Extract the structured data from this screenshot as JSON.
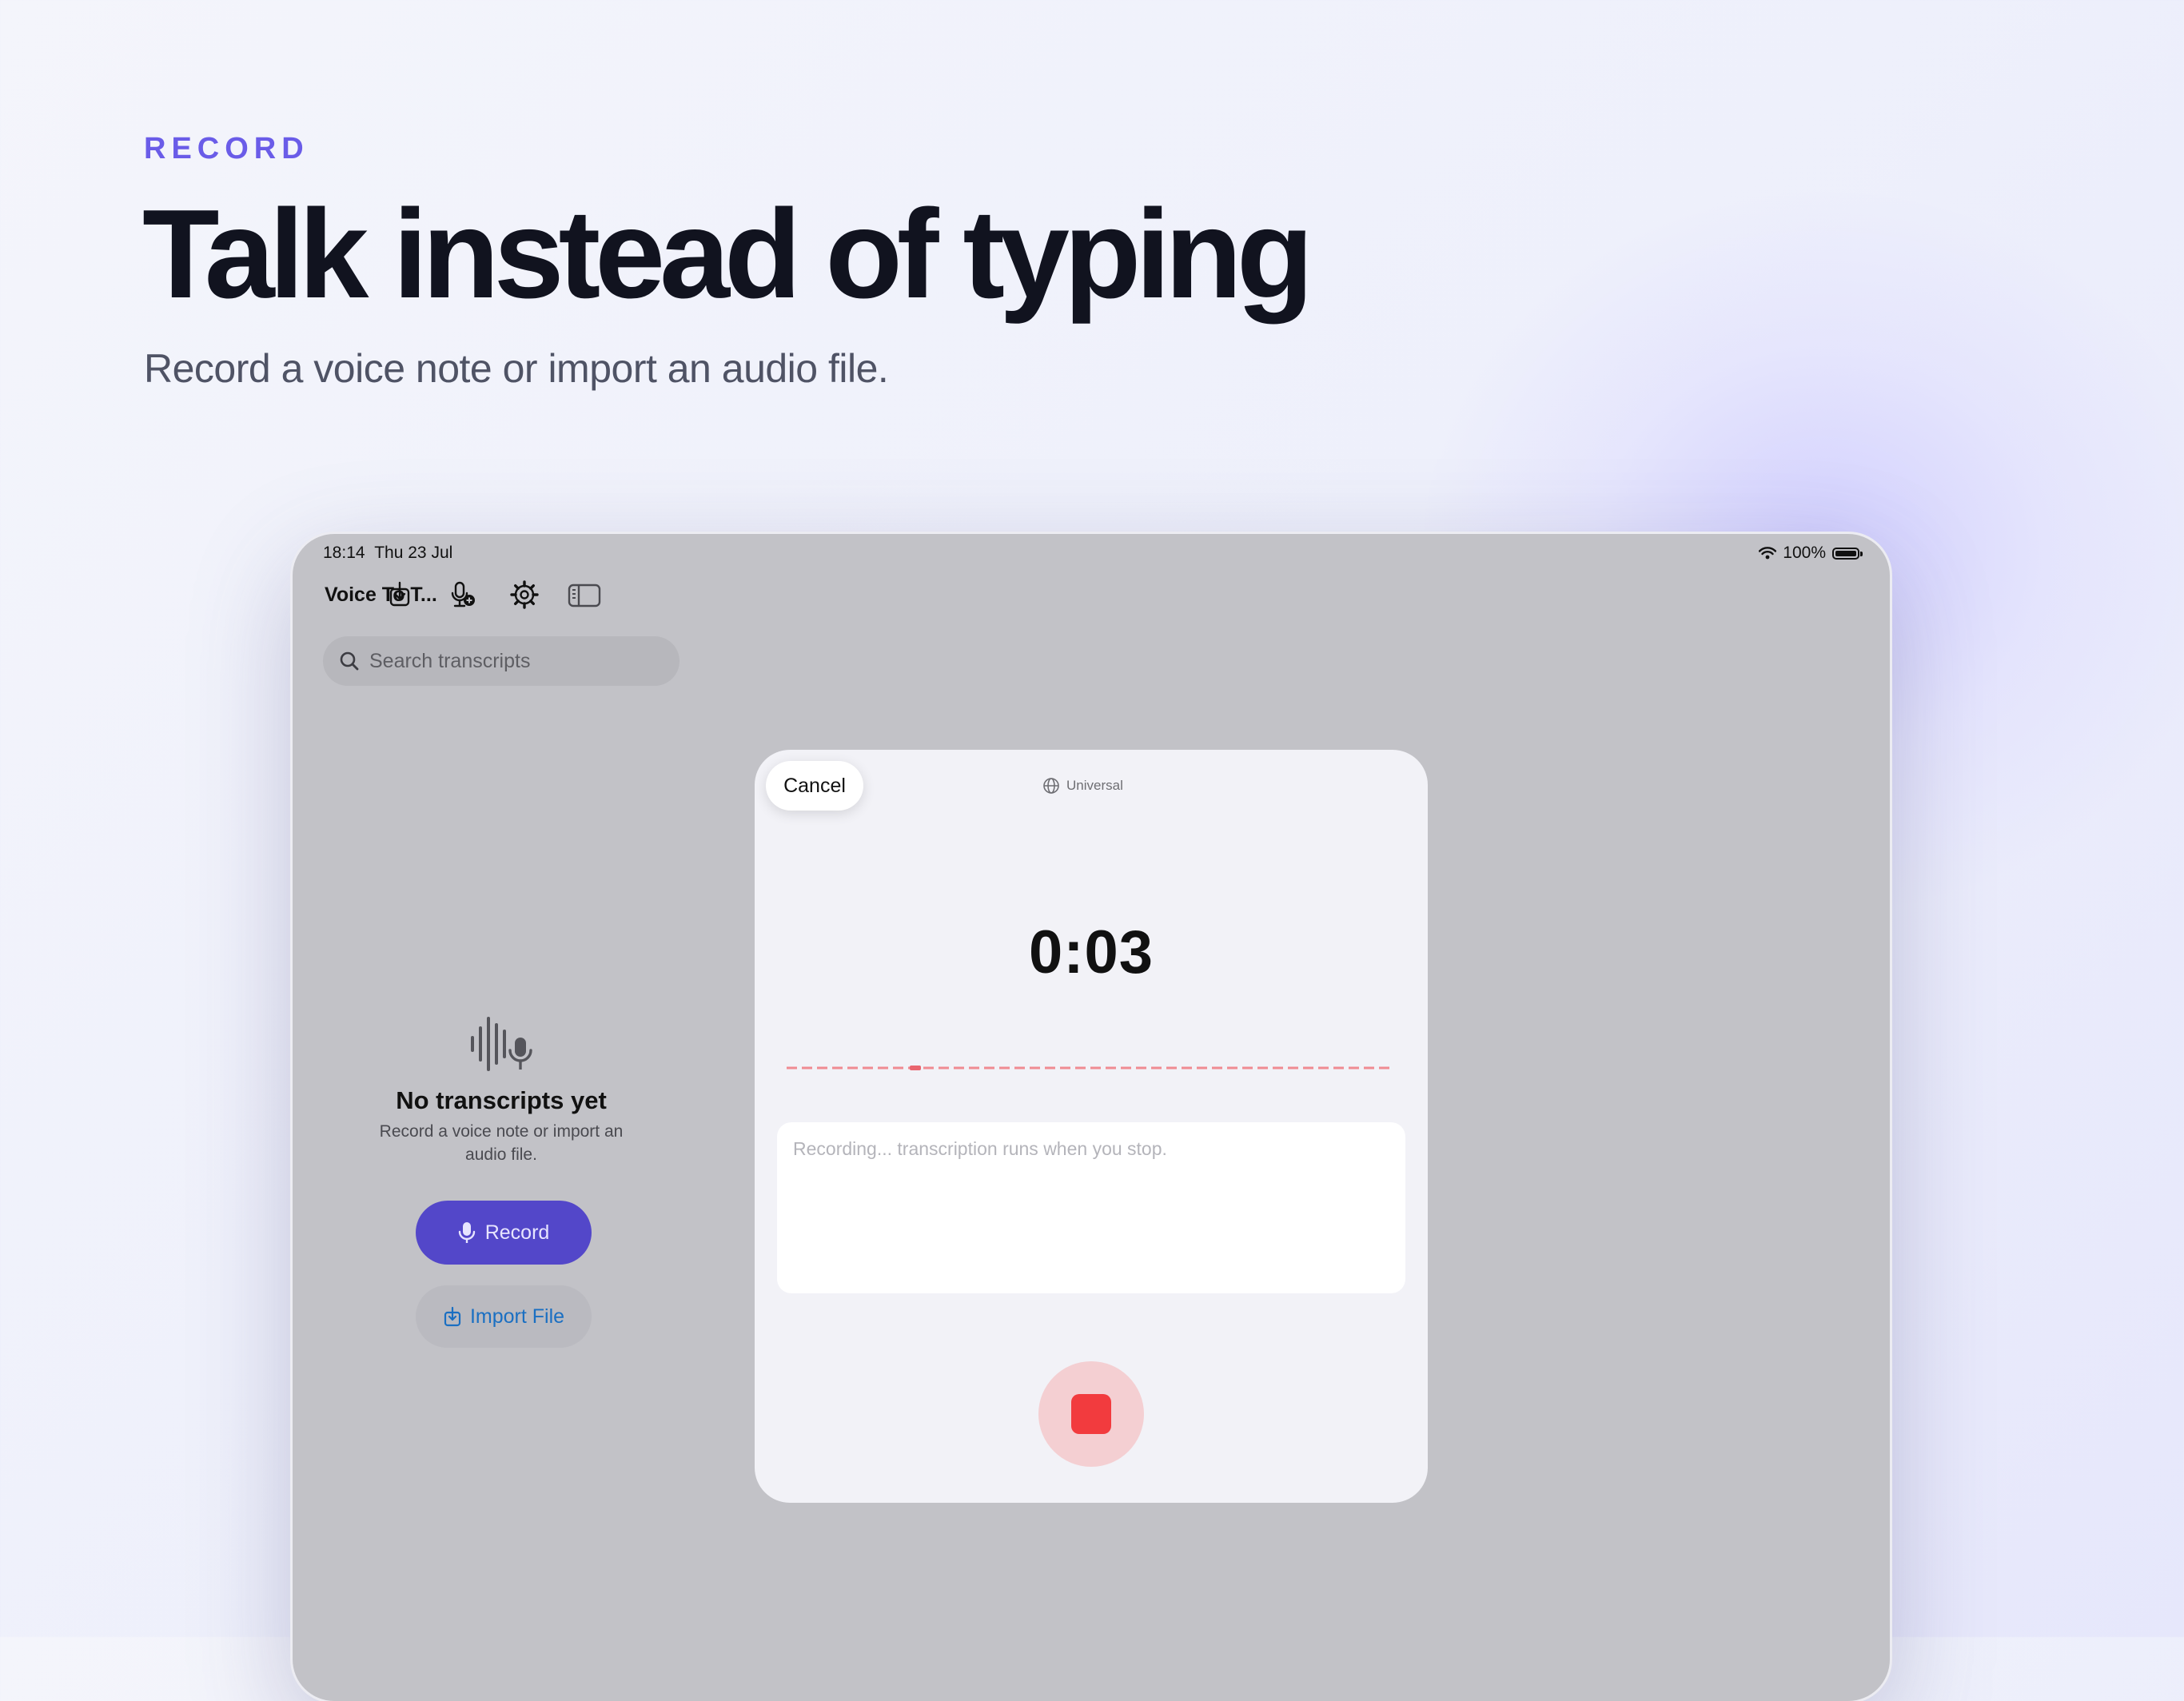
{
  "hero": {
    "eyebrow": "RECORD",
    "headline": "Talk instead of typing",
    "subhead": "Record a voice note or import an audio file."
  },
  "status_bar": {
    "time": "18:14",
    "date": "Thu 23 Jul",
    "battery": "100%"
  },
  "toolbar": {
    "app_title": "Voice To T...",
    "icons": [
      "import-icon",
      "mic-plus-icon",
      "gear-icon",
      "sidebar-toggle-icon"
    ]
  },
  "search": {
    "placeholder": "Search transcripts"
  },
  "empty_state": {
    "title": "No transcripts yet",
    "subtitle": "Record a voice note or import an audio file.",
    "record_label": "Record",
    "import_label": "Import File"
  },
  "recording_modal": {
    "cancel_label": "Cancel",
    "language": "Universal",
    "timer": "0:03",
    "transcript_placeholder": "Recording... transcription runs when you stop."
  },
  "colors": {
    "accent": "#6a5ce8",
    "record_button": "#5347c9",
    "import_link": "#1a6fc2",
    "stop_red": "#f23b3e"
  }
}
